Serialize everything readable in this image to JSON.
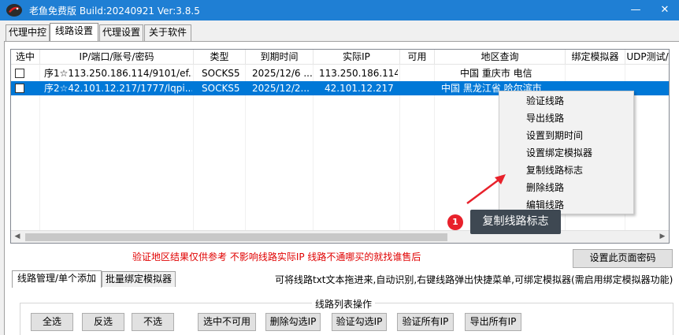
{
  "window": {
    "title": "老鱼免费版 Build:20240921 Ver:3.8.5",
    "minimize_glyph": "—",
    "close_glyph": "✕",
    "logo_icon": "fish-logo-icon"
  },
  "tabs": [
    {
      "label": "代理中控"
    },
    {
      "label": "线路设置",
      "active": true
    },
    {
      "label": "代理设置"
    },
    {
      "label": "关于软件"
    }
  ],
  "grid": {
    "columns": [
      "选中",
      "IP/端口/账号/密码",
      "类型",
      "到期时间",
      "实际IP",
      "可用",
      "地区查询",
      "绑定模拟器",
      "UDP测试/"
    ],
    "rows": [
      {
        "checked": false,
        "ip": "序1☆113.250.186.114/9101/ef...",
        "type": "SOCKS5",
        "expire": "2025/12/6 ...",
        "real_ip": "113.250.186.114",
        "available": "",
        "region": "中国  重庆市   电信",
        "emulator": "",
        "udp": "",
        "selected": false
      },
      {
        "checked": false,
        "ip": "序2☆42.101.12.217/1777/lqpi...",
        "type": "SOCKS5",
        "expire": "2025/12/2...",
        "real_ip": "42.101.12.217",
        "available": "",
        "region": "中国  黑龙江省  哈尔滨市",
        "emulator": "",
        "udp": "",
        "selected": true
      }
    ],
    "hscroll_left": "◀",
    "hscroll_right": "▶"
  },
  "context_menu": {
    "items": [
      "验证线路",
      "导出线路",
      "设置到期时间",
      "设置绑定模拟器",
      "复制线路标志",
      "删除线路",
      "编辑线路"
    ]
  },
  "annotation": {
    "number": "1",
    "label": "复制线路标志",
    "color": "#e8212b"
  },
  "notice": "验证地区结果仅供参考 不影响线路实际IP 线路不通哪买的就找谁售后",
  "page_password_button": "设置此页面密码",
  "subtabs": [
    {
      "label": "线路管理/单个添加",
      "active": true
    },
    {
      "label": "批量绑定模拟器"
    }
  ],
  "hint": "可将线路txt文本拖进来,自动识别,右键线路弹出快捷菜单,可绑定模拟器(需启用绑定模拟器功能)",
  "list_ops": {
    "title": "线路列表操作",
    "buttons": [
      "全选",
      "反选",
      "不选",
      "选中不可用",
      "删除勾选IP",
      "验证勾选IP",
      "验证所有IP",
      "导出所有IP"
    ]
  },
  "colors": {
    "titlebar": "#1f7fd4",
    "selection": "#0078d7",
    "notice_red": "#e00000",
    "tooltip_bg": "#3e4852"
  }
}
